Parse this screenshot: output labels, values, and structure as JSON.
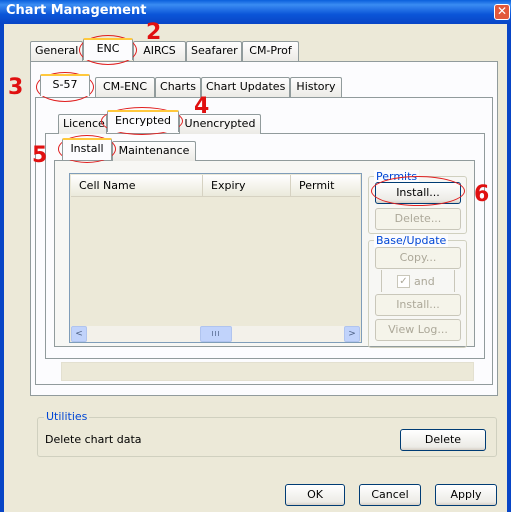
{
  "window": {
    "title": "Chart Management",
    "close": "✕"
  },
  "top_tabs": [
    "General",
    "ENC",
    "AIRCS",
    "Seafarer",
    "CM-Prof"
  ],
  "enc_tabs": [
    "S-57",
    "CM-ENC",
    "Charts",
    "Chart Updates",
    "History"
  ],
  "type_tabs": [
    "Licence",
    "Encrypted",
    "Unencrypted"
  ],
  "action_tabs": [
    "Install",
    "Maintenance"
  ],
  "list": {
    "columns": [
      "Cell Name",
      "Expiry",
      "Permit"
    ],
    "scroll_left": "<",
    "scroll_right": ">",
    "scroll_thumb": "III"
  },
  "permits": {
    "title": "Permits",
    "install": "Install...",
    "delete": "Delete..."
  },
  "base_update": {
    "title": "Base/Update",
    "copy": "Copy...",
    "and_label": "and",
    "check": "✓",
    "install": "Install...",
    "view_log": "View Log..."
  },
  "utilities": {
    "title": "Utilities",
    "label": "Delete chart data",
    "delete": "Delete"
  },
  "footer": {
    "ok": "OK",
    "cancel": "Cancel",
    "apply": "Apply"
  },
  "annotations": [
    "2",
    "3",
    "4",
    "5",
    "6"
  ],
  "colors": {
    "annotation": "#e01010",
    "titlebar": "#0b55d8",
    "tab_highlight": "#ffc83c"
  }
}
